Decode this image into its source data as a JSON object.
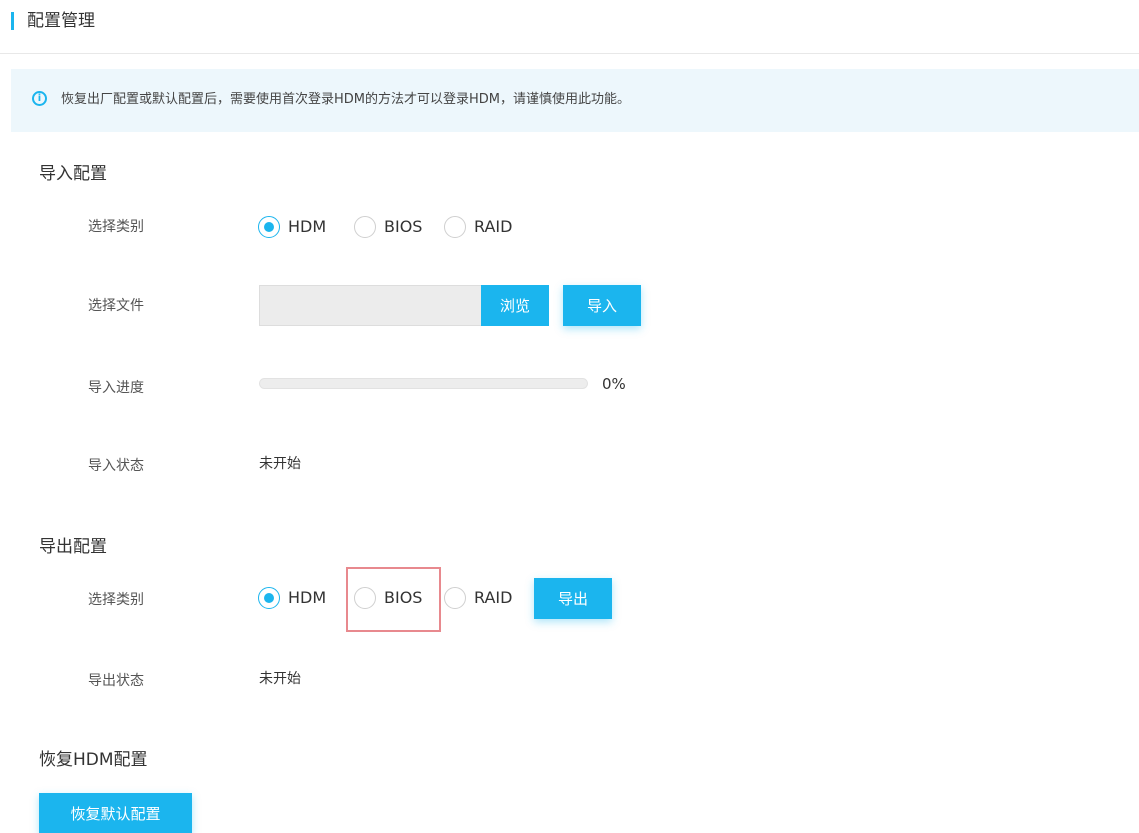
{
  "page": {
    "title": "配置管理"
  },
  "notice": {
    "text": "恢复出厂配置或默认配置后，需要使用首次登录HDM的方法才可以登录HDM，请谨慎使用此功能。",
    "icon": "info-icon"
  },
  "import_section": {
    "title": "导入配置",
    "category": {
      "label": "选择类别",
      "options": [
        "HDM",
        "BIOS",
        "RAID"
      ],
      "selected": "HDM"
    },
    "file": {
      "label": "选择文件",
      "value": "",
      "browse_label": "浏览",
      "import_label": "导入"
    },
    "progress": {
      "label": "导入进度",
      "percent": 0,
      "text": "0%"
    },
    "status": {
      "label": "导入状态",
      "value": "未开始"
    }
  },
  "export_section": {
    "title": "导出配置",
    "category": {
      "label": "选择类别",
      "options": [
        "HDM",
        "BIOS",
        "RAID"
      ],
      "selected": "HDM"
    },
    "export_label": "导出",
    "status": {
      "label": "导出状态",
      "value": "未开始"
    }
  },
  "restore_section": {
    "title": "恢复HDM配置",
    "button_label": "恢复默认配置"
  },
  "colors": {
    "accent": "#1bb5ee",
    "notice_bg": "#edf7fc",
    "highlight": "#e8898e"
  }
}
